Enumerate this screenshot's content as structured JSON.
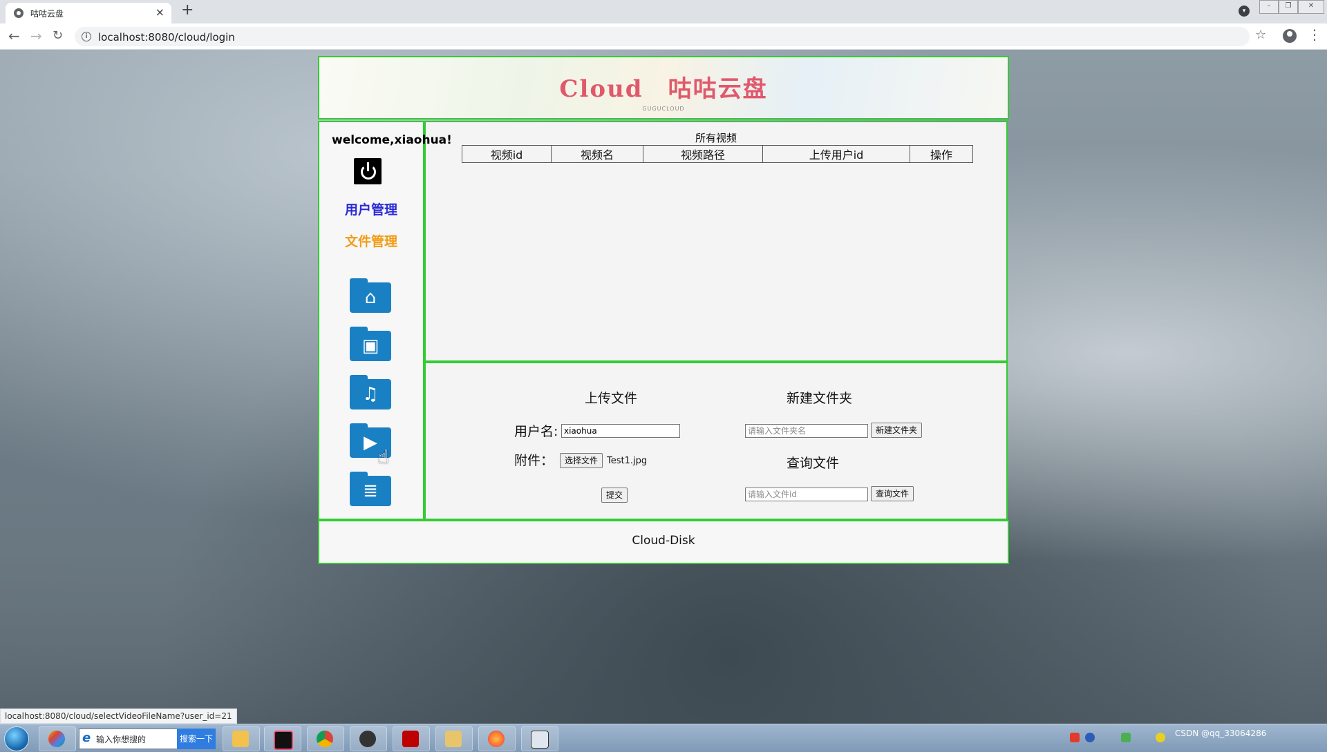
{
  "browser": {
    "tab_title": "咕咕云盘",
    "tab_close": "×",
    "new_tab": "+",
    "url": "localhost:8080/cloud/login",
    "status_url": "localhost:8080/cloud/selectVideoFileName?user_id=21"
  },
  "banner": {
    "title": "Cloud　咕咕云盘",
    "subtitle": "GUGUCLOUD"
  },
  "sidebar": {
    "welcome": "welcome,xiaohua!",
    "user_mgmt": "用户管理",
    "file_mgmt": "文件管理",
    "user_mgmt_color": "#2b2bd6",
    "file_mgmt_color": "#f29b14",
    "folders": [
      {
        "name": "home-folder-icon",
        "glyph": "⌂"
      },
      {
        "name": "image-folder-icon",
        "glyph": "▣"
      },
      {
        "name": "music-folder-icon",
        "glyph": "♫"
      },
      {
        "name": "video-folder-icon",
        "glyph": "▶"
      },
      {
        "name": "document-folder-icon",
        "glyph": "≣"
      }
    ]
  },
  "video_table": {
    "caption": "所有视频",
    "headers": [
      "视频id",
      "视频名",
      "视频路径",
      "上传用户id",
      "操作"
    ]
  },
  "upload": {
    "title": "上传文件",
    "username_label": "用户名:",
    "username_value": "xiaohua",
    "attachment_label": "附件：",
    "choose_file": "选择文件",
    "file_name": "Test1.jpg",
    "submit": "提交"
  },
  "new_folder": {
    "title": "新建文件夹",
    "placeholder": "请输入文件夹名",
    "button": "新建文件夹"
  },
  "query_file": {
    "title": "查询文件",
    "placeholder": "请输入文件id",
    "button": "查询文件"
  },
  "footer": {
    "text": "Cloud-Disk"
  },
  "taskbar": {
    "search_placeholder": "输入你想搜的",
    "search_button": "搜索一下",
    "tray_text": "CSDN @qq_33064286"
  },
  "colors": {
    "border_green": "#33cc33",
    "banner_red": "#e0586a",
    "folder_blue": "#1a80c4"
  }
}
